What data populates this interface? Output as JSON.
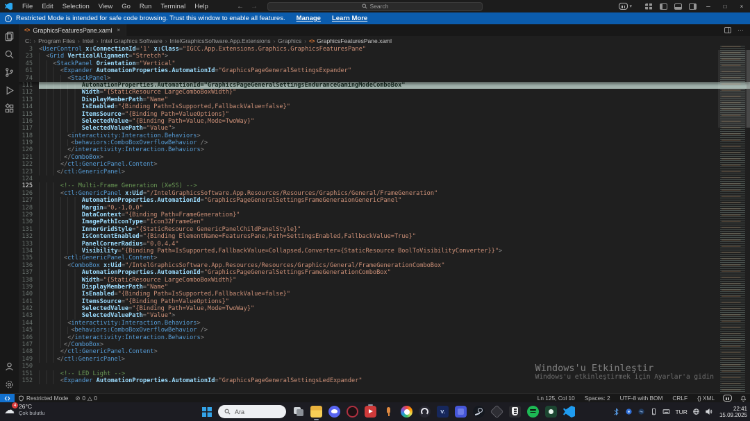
{
  "glyphs": {
    "back": "←",
    "forward": "→",
    "minimize": "─",
    "maximize": "□",
    "close": "×",
    "chevron_down": "▾",
    "breadcrumb_sep": "›",
    "error": "⊘",
    "warning": "△",
    "cloud": "☁",
    "file_xml": "<>",
    "tab_close": "×",
    "more": "⋯"
  },
  "titlebar": {
    "menus": [
      "File",
      "Edit",
      "Selection",
      "View",
      "Go",
      "Run",
      "Terminal",
      "Help"
    ],
    "search_placeholder": "Search"
  },
  "banner": {
    "message": "Restricted Mode is intended for safe code browsing. Trust this window to enable all features.",
    "manage_label": "Manage",
    "learn_more_label": "Learn More"
  },
  "activity_bar": {
    "top": [
      "explorer",
      "search",
      "source-control",
      "run-and-debug",
      "extensions"
    ],
    "bottom": [
      "accounts",
      "settings"
    ]
  },
  "tab": {
    "label": "GraphicsFeaturesPane.xaml"
  },
  "breadcrumbs": {
    "path": [
      "C:",
      "Program Files",
      "Intel",
      "Intel Graphics Software",
      "IntelGraphicsSoftware.App.Extensions",
      "Graphics"
    ],
    "file": "GraphicsFeaturesPane.xaml"
  },
  "editor": {
    "sticky_lines": [
      {
        "n": 3,
        "ind": 0,
        "t": "<UserControl x:ConnectionId='1' x:Class=\"IGCC.App.Extensions.Graphics.GraphicsFeaturesPane\""
      },
      {
        "n": 23,
        "ind": 2,
        "t": "<Grid VerticalAlignment=\"Stretch\">"
      },
      {
        "n": 45,
        "ind": 4,
        "t": "<StackPanel Orientation=\"Vertical\""
      },
      {
        "n": 61,
        "ind": 6,
        "t": "<Expander AutomationProperties.AutomationId=\"GraphicsPageGeneralSettingsExpander\""
      },
      {
        "n": 74,
        "ind": 8,
        "t": "<StackPanel>"
      }
    ],
    "lines": [
      {
        "n": 111,
        "ind": 12,
        "hl": true,
        "t": "AutomationProperties.AutomationId=\"GraphicsPageGeneralSettingsEnduranceGamingModeComboBox\""
      },
      {
        "n": 112,
        "ind": 12,
        "t": "Width=\"{StaticResource LargeComboBoxWidth}\""
      },
      {
        "n": 113,
        "ind": 12,
        "t": "DisplayMemberPath=\"Name\""
      },
      {
        "n": 114,
        "ind": 12,
        "t": "IsEnabled=\"{Binding Path=IsSupported,FallbackValue=false}\""
      },
      {
        "n": 115,
        "ind": 12,
        "t": "ItemsSource=\"{Binding Path=ValueOptions}\""
      },
      {
        "n": 116,
        "ind": 12,
        "t": "SelectedValue=\"{Binding Path=Value,Mode=TwoWay}\""
      },
      {
        "n": 117,
        "ind": 12,
        "t": "SelectedValuePath=\"Value\">"
      },
      {
        "n": 118,
        "ind": 8,
        "t": "<interactivity:Interaction.Behaviors>"
      },
      {
        "n": 119,
        "ind": 9,
        "t": "<behaviors:ComboBoxOverflowBehavior />"
      },
      {
        "n": 120,
        "ind": 8,
        "t": "</interactivity:Interaction.Behaviors>"
      },
      {
        "n": 121,
        "ind": 7,
        "t": "</ComboBox>"
      },
      {
        "n": 122,
        "ind": 6,
        "t": "</ctl:GenericPanel.Content>"
      },
      {
        "n": 123,
        "ind": 5,
        "t": "</ctl:GenericPanel>"
      },
      {
        "n": 124,
        "ind": 0,
        "t": ""
      },
      {
        "n": 125,
        "ind": 6,
        "active": true,
        "t": "<!-- Multi-Frame Generation (XeSS) -->"
      },
      {
        "n": 126,
        "ind": 6,
        "t": "<ctl:GenericPanel x:Uid=\"/IntelGraphicsSoftware.App.Resources/Resources/Graphics/General/FrameGeneration\""
      },
      {
        "n": 127,
        "ind": 12,
        "t": "AutomationProperties.AutomationId=\"GraphicsPageGeneralSettingsFrameGeneraionGenericPanel\""
      },
      {
        "n": 128,
        "ind": 12,
        "t": "Margin=\"0,-1,0,0\""
      },
      {
        "n": 129,
        "ind": 12,
        "t": "DataContext=\"{Binding Path=FrameGeneration}\""
      },
      {
        "n": 130,
        "ind": 12,
        "t": "ImagePathIconType=\"Icon32FrameGen\""
      },
      {
        "n": 131,
        "ind": 12,
        "t": "InnerGridStyle=\"{StaticResource GenericPanelChildPanelStyle}\""
      },
      {
        "n": 132,
        "ind": 12,
        "t": "IsContentEnabled=\"{Binding ElementName=FeaturesPane,Path=SettingsEnabled,FallbackValue=True}\""
      },
      {
        "n": 133,
        "ind": 12,
        "t": "PanelCornerRadius=\"0,0,4,4\""
      },
      {
        "n": 134,
        "ind": 12,
        "t": "Visibility=\"{Binding Path=IsSupported,FallbackValue=Collapsed,Converter={StaticResource BoolToVisibilityConverter}}\">"
      },
      {
        "n": 135,
        "ind": 7,
        "t": "<ctl:GenericPanel.Content>"
      },
      {
        "n": 136,
        "ind": 8,
        "t": "<ComboBox x:Uid=\"/IntelGraphicsSoftware.App.Resources/Resources/Graphics/General/FrameGenerationComboBox\""
      },
      {
        "n": 137,
        "ind": 12,
        "t": "AutomationProperties.AutomationId=\"GraphicsPageGeneralSettingsFrameGenerationComboBox\""
      },
      {
        "n": 138,
        "ind": 12,
        "t": "Width=\"{StaticResource LargeComboBoxWidth}\""
      },
      {
        "n": 139,
        "ind": 12,
        "t": "DisplayMemberPath=\"Name\""
      },
      {
        "n": 140,
        "ind": 12,
        "t": "IsEnabled=\"{Binding Path=IsSupported,FallbackValue=false}\""
      },
      {
        "n": 141,
        "ind": 12,
        "t": "ItemsSource=\"{Binding Path=ValueOptions}\""
      },
      {
        "n": 142,
        "ind": 12,
        "t": "SelectedValue=\"{Binding Path=Value,Mode=TwoWay}\""
      },
      {
        "n": 143,
        "ind": 12,
        "t": "SelectedValuePath=\"Value\">"
      },
      {
        "n": 144,
        "ind": 8,
        "t": "<interactivity:Interaction.Behaviors>"
      },
      {
        "n": 145,
        "ind": 9,
        "t": "<behaviors:ComboBoxOverflowBehavior />"
      },
      {
        "n": 146,
        "ind": 8,
        "t": "</interactivity:Interaction.Behaviors>"
      },
      {
        "n": 147,
        "ind": 7,
        "t": "</ComboBox>"
      },
      {
        "n": 148,
        "ind": 6,
        "t": "</ctl:GenericPanel.Content>"
      },
      {
        "n": 149,
        "ind": 5,
        "t": "</ctl:GenericPanel>"
      },
      {
        "n": 150,
        "ind": 0,
        "t": ""
      },
      {
        "n": 151,
        "ind": 6,
        "t": "<!-- LED Light -->"
      },
      {
        "n": 152,
        "ind": 6,
        "t": "<Expander AutomationProperties.AutomationId=\"GraphicsPageGeneralSettingsLedExpander\""
      }
    ]
  },
  "watermark": {
    "line1": "Windows'u Etkinleştir",
    "line2": "Windows'u etkinleştirmek için Ayarlar'a gidin"
  },
  "statusbar": {
    "restricted_label": "Restricted Mode",
    "errors": "0",
    "warnings": "0",
    "items": [
      "Ln 125, Col 10",
      "Spaces: 2",
      "UTF-8 with BOM",
      "CRLF",
      "{} XML"
    ]
  },
  "taskbar": {
    "weather": {
      "badge": "4",
      "temp": "26°C",
      "condition": "Çok bulutlu"
    },
    "search_placeholder": "Ara",
    "apps": [
      {
        "name": "task-view",
        "cls": "app-task-view"
      },
      {
        "name": "file-explorer",
        "cls": "app-file-explorer",
        "open": true
      },
      {
        "name": "discord",
        "cls": "app-discord"
      },
      {
        "name": "ring-app",
        "cls": "app-ring"
      },
      {
        "name": "media-app",
        "cls": "app-media",
        "open": true
      },
      {
        "name": "microphone-app",
        "cls": "app-mic"
      },
      {
        "name": "photos-app",
        "cls": "app-photos"
      },
      {
        "name": "obs",
        "cls": "app-obs"
      },
      {
        "name": "v-app",
        "cls": "app-vapp",
        "glyph": "V."
      },
      {
        "name": "blue-app",
        "cls": "app-blueapp"
      },
      {
        "name": "steam",
        "cls": "app-steam"
      },
      {
        "name": "diamond-app",
        "cls": "app-diamond"
      },
      {
        "name": "epic-games",
        "cls": "app-epic"
      },
      {
        "name": "spotify",
        "cls": "app-spotify"
      },
      {
        "name": "green-app",
        "cls": "app-greenapp"
      },
      {
        "name": "vscode",
        "cls": "app-vscode",
        "active": true
      }
    ],
    "tray": {
      "icons_left": [
        "bluetooth",
        "tray-app-blue",
        "tray-app-dark",
        "phone-link",
        "touch-keyboard"
      ],
      "language": "TUR",
      "icons_right": [
        "network-globe",
        "volume"
      ],
      "time": "22:41",
      "date": "15.09.2025"
    }
  },
  "colors": {
    "banner_blue": "#0b5cad",
    "remote_blue": "#1271cf",
    "accent_vscode": "#1f9cf0",
    "highlight_line": "#a3b4ae",
    "taskbar_badge_red": "#d83b3b"
  }
}
